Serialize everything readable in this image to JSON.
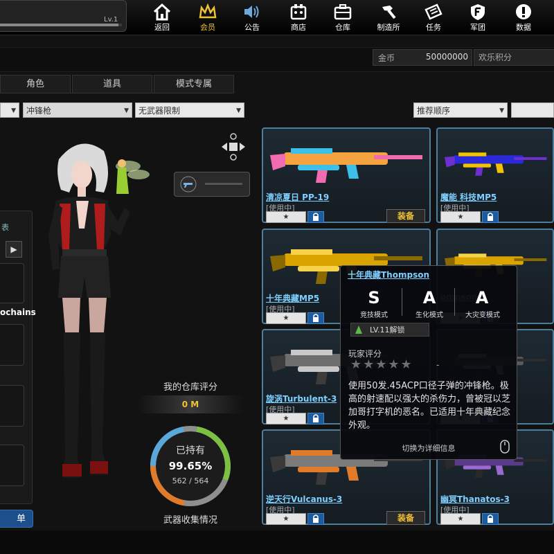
{
  "player": {
    "level_label": "Lv.1",
    "level_progress": 0.97
  },
  "nav": [
    {
      "id": "back",
      "label": "返回",
      "icon": "home-icon"
    },
    {
      "id": "vip",
      "label": "会员",
      "icon": "crown-icon",
      "active": true
    },
    {
      "id": "notice",
      "label": "公告",
      "icon": "speaker-icon"
    },
    {
      "id": "shop",
      "label": "商店",
      "icon": "shop-icon"
    },
    {
      "id": "storage",
      "label": "仓库",
      "icon": "briefcase-icon"
    },
    {
      "id": "craft",
      "label": "制造所",
      "icon": "hammer-icon"
    },
    {
      "id": "tasks",
      "label": "任务",
      "icon": "ticket-icon"
    },
    {
      "id": "clan",
      "label": "军团",
      "icon": "shield-f-icon"
    },
    {
      "id": "data",
      "label": "数据",
      "icon": "info-icon"
    }
  ],
  "currency": {
    "gold_label": "金币",
    "gold_value": "50000000",
    "points_label": "欢乐积分"
  },
  "tabs": [
    "角色",
    "道具",
    "模式专属"
  ],
  "filters": {
    "weapon_type": "冲锋枪",
    "weapon_limit": "无武器限制",
    "sort": "推荐顺序"
  },
  "left_panel": {
    "chip": "表",
    "text": "ochains",
    "bottom_button": "单"
  },
  "score": {
    "title": "我的仓库评分",
    "value": "0 M"
  },
  "collection": {
    "label": "已持有",
    "percent": "99.65%",
    "count": "562 / 564",
    "percent_value": 99.65,
    "footer": "武器收集情况"
  },
  "weapons": [
    {
      "name": "清凉夏日 PP-19",
      "status": "[使用中]",
      "equip": "装备",
      "theme": "summer"
    },
    {
      "name": "魔能 科技MP5",
      "status": "[使用中]",
      "equip": "",
      "theme": "tech"
    },
    {
      "name": "十年典藏MP5",
      "status": "[使用中]",
      "equip": "",
      "theme": "gold"
    },
    {
      "name": "ompson",
      "status": "",
      "equip": "",
      "theme": "gold2"
    },
    {
      "name": "旋涡Turbulent-3",
      "status": "[使用中]",
      "equip": "",
      "theme": "dark"
    },
    {
      "name": "",
      "status": "",
      "equip": "",
      "theme": "dark2"
    },
    {
      "name": "逆天行Vulcanus-3",
      "status": "[使用中]",
      "equip": "装备",
      "theme": "vulcan"
    },
    {
      "name": "幽冥Thanatos-3",
      "status": "[使用中]",
      "equip": "",
      "theme": "thanatos"
    }
  ],
  "star_symbol": "★",
  "tooltip": {
    "title": "十年典藏Thompson",
    "grades": [
      {
        "grade": "S",
        "mode": "竞技模式"
      },
      {
        "grade": "A",
        "mode": "生化模式"
      },
      {
        "grade": "A",
        "mode": "大灾变模式"
      }
    ],
    "unlock": "LV.11解锁",
    "rating_label": "玩家评分",
    "stars": "★★★★★",
    "rating_tail": "-",
    "description": "使用50发.45ACP口径子弹的冲锋枪。极高的射速配以强大的杀伤力，曾被冠以芝加哥打字机的恶名。已适用十年典藏纪念外观。",
    "switch_hint": "切换为详细信息"
  }
}
